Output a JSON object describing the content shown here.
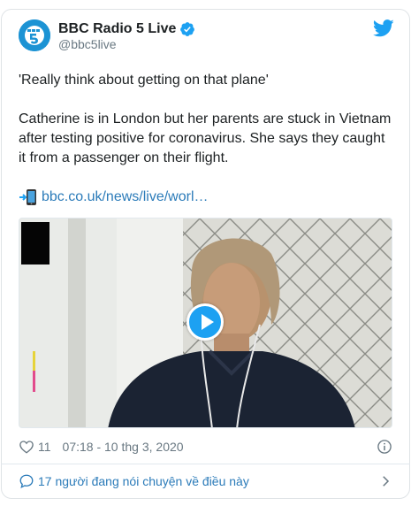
{
  "account": {
    "display_name": "BBC Radio 5 Live",
    "handle": "@bbc5live",
    "avatar_icon": "bbc-5-live-logo-icon",
    "verified_icon": "verified-badge-icon"
  },
  "tweet": {
    "line1": "'Really think about getting on that plane'",
    "body": "Catherine is in London but her parents are stuck in Vietnam after testing positive for coronavirus. She says they caught it from a passenger on their flight.",
    "link_icon": "mobile-phone-arrow-icon",
    "link_text": "bbc.co.uk/news/live/worl…"
  },
  "media": {
    "type": "video",
    "play_icon": "play-icon"
  },
  "footer": {
    "like_count": "11",
    "timestamp": "07:18 - 10 thg 3, 2020"
  },
  "conversation": {
    "text": "17 người đang nói chuyện về điều này"
  },
  "colors": {
    "brand_blue": "#1da1f2",
    "link_blue": "#2b7bb9",
    "muted_text": "#697882",
    "border": "#dfe3e6"
  }
}
